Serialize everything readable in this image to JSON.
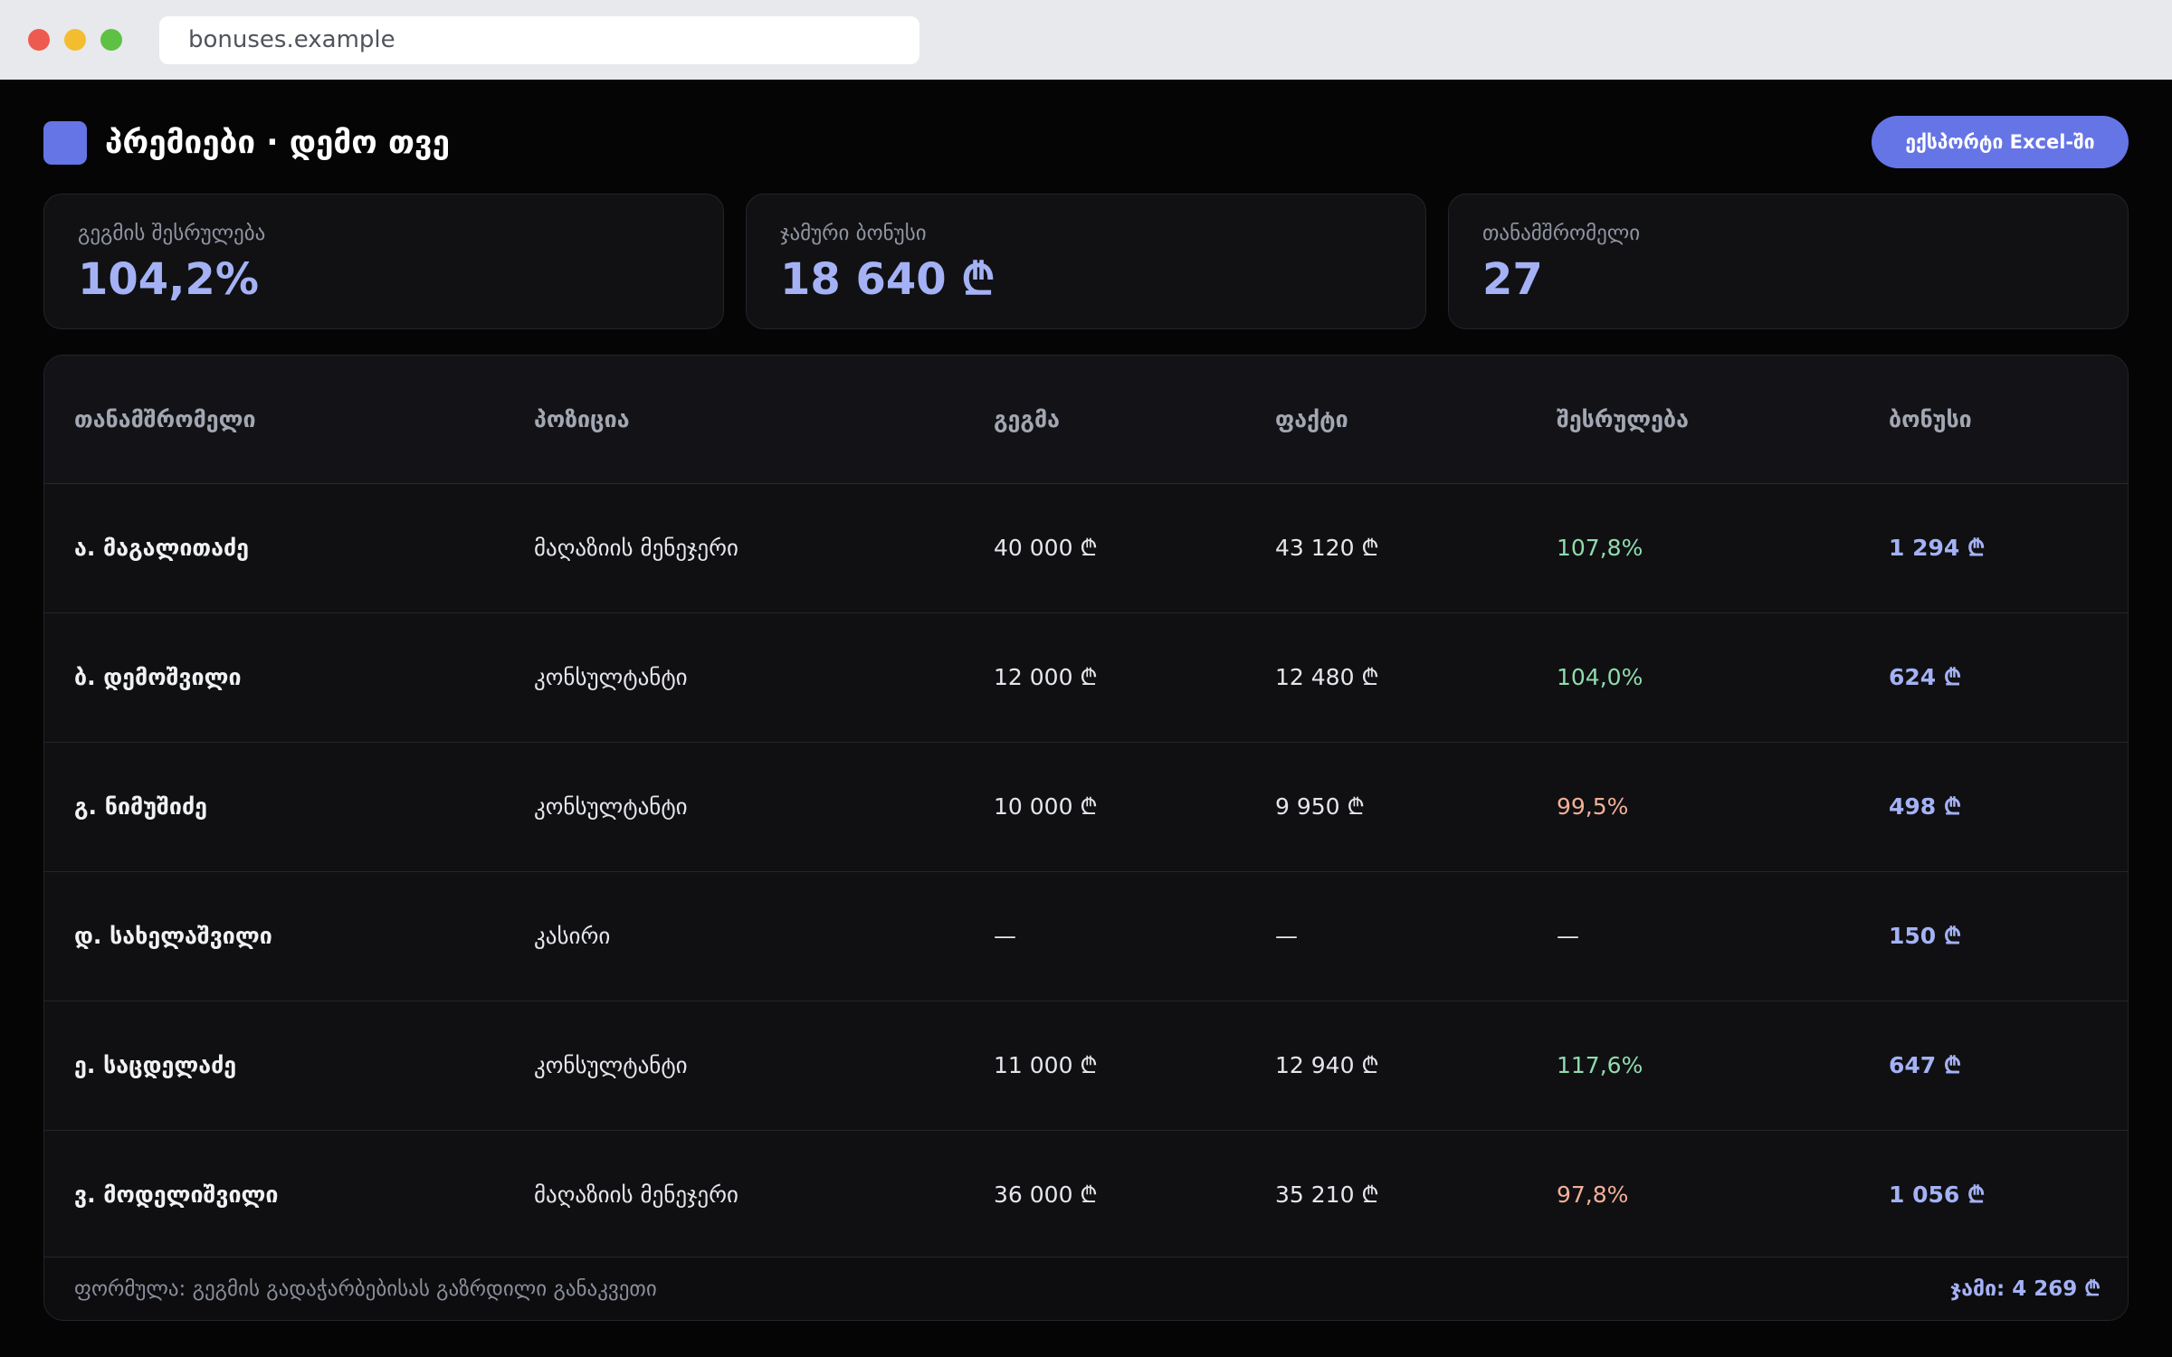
{
  "browser": {
    "url": "bonuses.example"
  },
  "header": {
    "title": "პრემიები · დემო თვე",
    "export_label": "ექსპორტი Excel-ში"
  },
  "kpis": [
    {
      "label": "გეგმის შესრულება",
      "value": "104,2%"
    },
    {
      "label": "ჯამური ბონუსი",
      "value": "18 640 ₾"
    },
    {
      "label": "თანამშრომელი",
      "value": "27"
    }
  ],
  "table": {
    "headers": [
      "თანამშრომელი",
      "პოზიცია",
      "გეგმა",
      "ფაქტი",
      "შესრულება",
      "ბონუსი"
    ],
    "rows": [
      {
        "name": "ა. მაგალითაძე",
        "position": "მაღაზიის მენეჯერი",
        "plan": "40 000 ₾",
        "actual": "43 120 ₾",
        "completion": "107,8%",
        "bonus": "1 294 ₾"
      },
      {
        "name": "ბ. დემოშვილი",
        "position": "კონსულტანტი",
        "plan": "12 000 ₾",
        "actual": "12 480 ₾",
        "completion": "104,0%",
        "bonus": "624 ₾"
      },
      {
        "name": "გ. ნიმუშიძე",
        "position": "კონსულტანტი",
        "plan": "10 000 ₾",
        "actual": "9 950 ₾",
        "completion": "99,5%",
        "bonus": "498 ₾"
      },
      {
        "name": "დ. სახელაშვილი",
        "position": "კასირი",
        "plan": "—",
        "actual": "—",
        "completion": "—",
        "bonus": "150 ₾"
      },
      {
        "name": "ე. საცდელაძე",
        "position": "კონსულტანტი",
        "plan": "11 000 ₾",
        "actual": "12 940 ₾",
        "completion": "117,6%",
        "bonus": "647 ₾"
      },
      {
        "name": "ვ. მოდელიშვილი",
        "position": "მაღაზიის მენეჯერი",
        "plan": "36 000 ₾",
        "actual": "35 210 ₾",
        "completion": "97,8%",
        "bonus": "1 056 ₾"
      }
    ],
    "footer": {
      "formula": "ფორმულა: გეგმის გადაჭარბებისას გაზრდილი განაკვეთი",
      "total": "ჯამი: 4 269 ₾"
    }
  },
  "colors": {
    "accent": "#6575e6",
    "value": "#a4b2f5",
    "good": "#8fdcae",
    "bad": "#f3b097",
    "background": "#050506"
  }
}
